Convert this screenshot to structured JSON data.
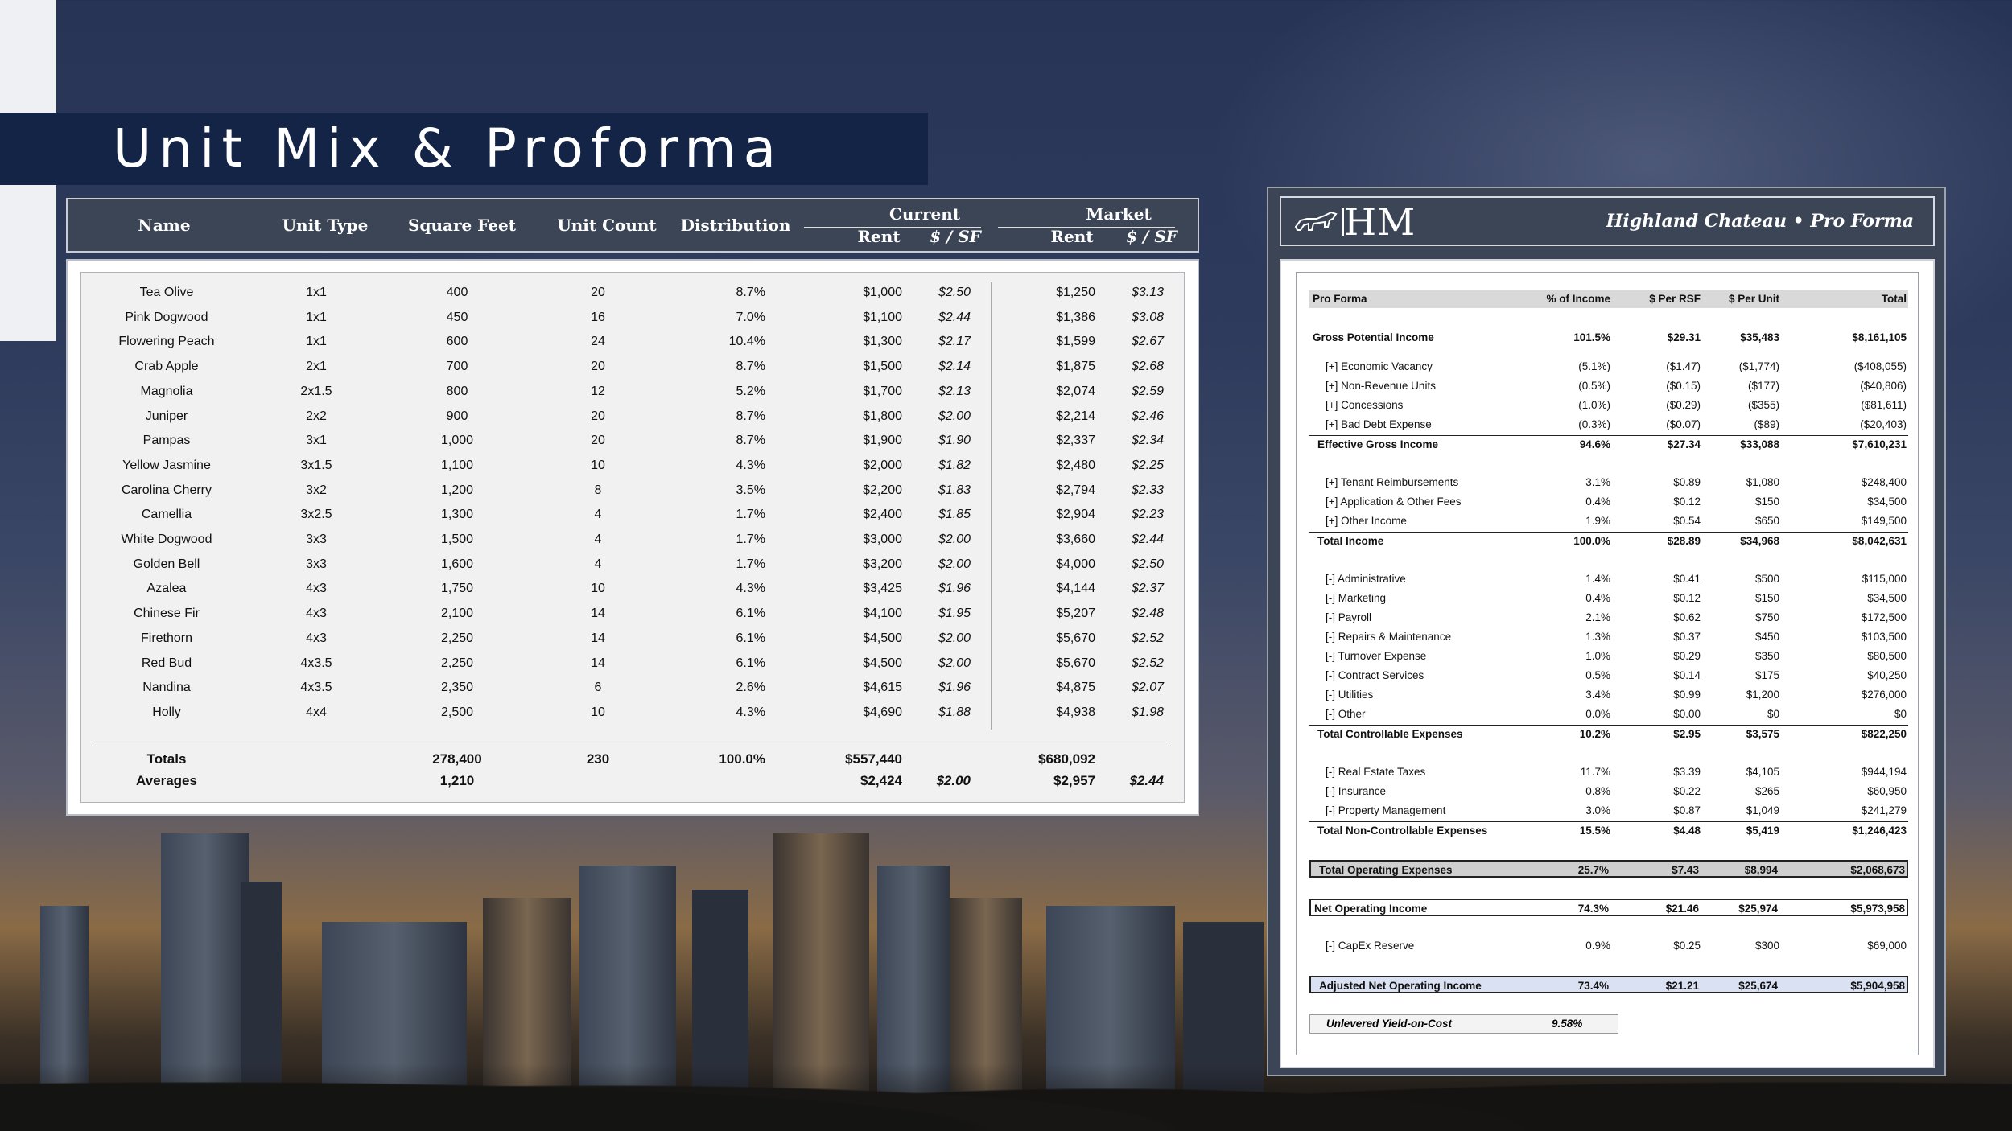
{
  "title": "Unit Mix & Proforma",
  "unit_mix": {
    "headers": {
      "name": "Name",
      "unit_type": "Unit Type",
      "square_feet": "Square Feet",
      "unit_count": "Unit Count",
      "distribution": "Distribution",
      "current": "Current",
      "market": "Market",
      "rent": "Rent",
      "psf": "$ / SF"
    },
    "rows": [
      {
        "name": "Tea Olive",
        "type": "1x1",
        "sf": "400",
        "count": "20",
        "dist": "8.7%",
        "rent": "$1,000",
        "psf": "$2.50",
        "mrent": "$1,250",
        "mpsf": "$3.13"
      },
      {
        "name": "Pink Dogwood",
        "type": "1x1",
        "sf": "450",
        "count": "16",
        "dist": "7.0%",
        "rent": "$1,100",
        "psf": "$2.44",
        "mrent": "$1,386",
        "mpsf": "$3.08"
      },
      {
        "name": "Flowering Peach",
        "type": "1x1",
        "sf": "600",
        "count": "24",
        "dist": "10.4%",
        "rent": "$1,300",
        "psf": "$2.17",
        "mrent": "$1,599",
        "mpsf": "$2.67"
      },
      {
        "name": "Crab Apple",
        "type": "2x1",
        "sf": "700",
        "count": "20",
        "dist": "8.7%",
        "rent": "$1,500",
        "psf": "$2.14",
        "mrent": "$1,875",
        "mpsf": "$2.68"
      },
      {
        "name": "Magnolia",
        "type": "2x1.5",
        "sf": "800",
        "count": "12",
        "dist": "5.2%",
        "rent": "$1,700",
        "psf": "$2.13",
        "mrent": "$2,074",
        "mpsf": "$2.59"
      },
      {
        "name": "Juniper",
        "type": "2x2",
        "sf": "900",
        "count": "20",
        "dist": "8.7%",
        "rent": "$1,800",
        "psf": "$2.00",
        "mrent": "$2,214",
        "mpsf": "$2.46"
      },
      {
        "name": "Pampas",
        "type": "3x1",
        "sf": "1,000",
        "count": "20",
        "dist": "8.7%",
        "rent": "$1,900",
        "psf": "$1.90",
        "mrent": "$2,337",
        "mpsf": "$2.34"
      },
      {
        "name": "Yellow Jasmine",
        "type": "3x1.5",
        "sf": "1,100",
        "count": "10",
        "dist": "4.3%",
        "rent": "$2,000",
        "psf": "$1.82",
        "mrent": "$2,480",
        "mpsf": "$2.25"
      },
      {
        "name": "Carolina Cherry",
        "type": "3x2",
        "sf": "1,200",
        "count": "8",
        "dist": "3.5%",
        "rent": "$2,200",
        "psf": "$1.83",
        "mrent": "$2,794",
        "mpsf": "$2.33"
      },
      {
        "name": "Camellia",
        "type": "3x2.5",
        "sf": "1,300",
        "count": "4",
        "dist": "1.7%",
        "rent": "$2,400",
        "psf": "$1.85",
        "mrent": "$2,904",
        "mpsf": "$2.23"
      },
      {
        "name": "White Dogwood",
        "type": "3x3",
        "sf": "1,500",
        "count": "4",
        "dist": "1.7%",
        "rent": "$3,000",
        "psf": "$2.00",
        "mrent": "$3,660",
        "mpsf": "$2.44"
      },
      {
        "name": "Golden Bell",
        "type": "3x3",
        "sf": "1,600",
        "count": "4",
        "dist": "1.7%",
        "rent": "$3,200",
        "psf": "$2.00",
        "mrent": "$4,000",
        "mpsf": "$2.50"
      },
      {
        "name": "Azalea",
        "type": "4x3",
        "sf": "1,750",
        "count": "10",
        "dist": "4.3%",
        "rent": "$3,425",
        "psf": "$1.96",
        "mrent": "$4,144",
        "mpsf": "$2.37"
      },
      {
        "name": "Chinese Fir",
        "type": "4x3",
        "sf": "2,100",
        "count": "14",
        "dist": "6.1%",
        "rent": "$4,100",
        "psf": "$1.95",
        "mrent": "$5,207",
        "mpsf": "$2.48"
      },
      {
        "name": "Firethorn",
        "type": "4x3",
        "sf": "2,250",
        "count": "14",
        "dist": "6.1%",
        "rent": "$4,500",
        "psf": "$2.00",
        "mrent": "$5,670",
        "mpsf": "$2.52"
      },
      {
        "name": "Red Bud",
        "type": "4x3.5",
        "sf": "2,250",
        "count": "14",
        "dist": "6.1%",
        "rent": "$4,500",
        "psf": "$2.00",
        "mrent": "$5,670",
        "mpsf": "$2.52"
      },
      {
        "name": "Nandina",
        "type": "4x3.5",
        "sf": "2,350",
        "count": "6",
        "dist": "2.6%",
        "rent": "$4,615",
        "psf": "$1.96",
        "mrent": "$4,875",
        "mpsf": "$2.07"
      },
      {
        "name": "Holly",
        "type": "4x4",
        "sf": "2,500",
        "count": "10",
        "dist": "4.3%",
        "rent": "$4,690",
        "psf": "$1.88",
        "mrent": "$4,938",
        "mpsf": "$1.98"
      }
    ],
    "totals": {
      "label": "Totals",
      "sf": "278,400",
      "count": "230",
      "dist": "100.0%",
      "rent": "$557,440",
      "mrent": "$680,092"
    },
    "averages": {
      "label": "Averages",
      "sf": "1,210",
      "rent": "$2,424",
      "psf": "$2.00",
      "mrent": "$2,957",
      "mpsf": "$2.44"
    }
  },
  "proforma": {
    "logo_text": "HM",
    "title": "Highland Chateau • Pro Forma",
    "headers": {
      "label": "Pro Forma",
      "c1": "% of Income",
      "c2": "$ Per RSF",
      "c3": "$ Per Unit",
      "c4": "Total"
    },
    "rows": [
      {
        "label": "Gross Potential Income",
        "c1": "101.5%",
        "c2": "$29.31",
        "c3": "$35,483",
        "c4": "$8,161,105"
      },
      {
        "label": "[+] Economic Vacancy",
        "c1": "(5.1%)",
        "c2": "($1.47)",
        "c3": "($1,774)",
        "c4": "($408,055)"
      },
      {
        "label": "[+] Non-Revenue Units",
        "c1": "(0.5%)",
        "c2": "($0.15)",
        "c3": "($177)",
        "c4": "($40,806)"
      },
      {
        "label": "[+] Concessions",
        "c1": "(1.0%)",
        "c2": "($0.29)",
        "c3": "($355)",
        "c4": "($81,611)"
      },
      {
        "label": "[+] Bad Debt Expense",
        "c1": "(0.3%)",
        "c2": "($0.07)",
        "c3": "($89)",
        "c4": "($20,403)"
      },
      {
        "label": "Effective Gross Income",
        "c1": "94.6%",
        "c2": "$27.34",
        "c3": "$33,088",
        "c4": "$7,610,231"
      },
      {
        "label": "[+] Tenant Reimbursements",
        "c1": "3.1%",
        "c2": "$0.89",
        "c3": "$1,080",
        "c4": "$248,400"
      },
      {
        "label": "[+] Application & Other Fees",
        "c1": "0.4%",
        "c2": "$0.12",
        "c3": "$150",
        "c4": "$34,500"
      },
      {
        "label": "[+] Other Income",
        "c1": "1.9%",
        "c2": "$0.54",
        "c3": "$650",
        "c4": "$149,500"
      },
      {
        "label": "Total Income",
        "c1": "100.0%",
        "c2": "$28.89",
        "c3": "$34,968",
        "c4": "$8,042,631"
      },
      {
        "label": "[-] Administrative",
        "c1": "1.4%",
        "c2": "$0.41",
        "c3": "$500",
        "c4": "$115,000"
      },
      {
        "label": "[-] Marketing",
        "c1": "0.4%",
        "c2": "$0.12",
        "c3": "$150",
        "c4": "$34,500"
      },
      {
        "label": "[-] Payroll",
        "c1": "2.1%",
        "c2": "$0.62",
        "c3": "$750",
        "c4": "$172,500"
      },
      {
        "label": "[-] Repairs & Maintenance",
        "c1": "1.3%",
        "c2": "$0.37",
        "c3": "$450",
        "c4": "$103,500"
      },
      {
        "label": "[-] Turnover Expense",
        "c1": "1.0%",
        "c2": "$0.29",
        "c3": "$350",
        "c4": "$80,500"
      },
      {
        "label": "[-] Contract Services",
        "c1": "0.5%",
        "c2": "$0.14",
        "c3": "$175",
        "c4": "$40,250"
      },
      {
        "label": "[-] Utilities",
        "c1": "3.4%",
        "c2": "$0.99",
        "c3": "$1,200",
        "c4": "$276,000"
      },
      {
        "label": "[-] Other",
        "c1": "0.0%",
        "c2": "$0.00",
        "c3": "$0",
        "c4": "$0"
      },
      {
        "label": "Total Controllable Expenses",
        "c1": "10.2%",
        "c2": "$2.95",
        "c3": "$3,575",
        "c4": "$822,250"
      },
      {
        "label": "[-] Real Estate Taxes",
        "c1": "11.7%",
        "c2": "$3.39",
        "c3": "$4,105",
        "c4": "$944,194"
      },
      {
        "label": "[-] Insurance",
        "c1": "0.8%",
        "c2": "$0.22",
        "c3": "$265",
        "c4": "$60,950"
      },
      {
        "label": "[-] Property Management",
        "c1": "3.0%",
        "c2": "$0.87",
        "c3": "$1,049",
        "c4": "$241,279"
      },
      {
        "label": "Total Non-Controllable Expenses",
        "c1": "15.5%",
        "c2": "$4.48",
        "c3": "$5,419",
        "c4": "$1,246,423"
      },
      {
        "label": "Total Operating Expenses",
        "c1": "25.7%",
        "c2": "$7.43",
        "c3": "$8,994",
        "c4": "$2,068,673"
      },
      {
        "label": "Net Operating Income",
        "c1": "74.3%",
        "c2": "$21.46",
        "c3": "$25,974",
        "c4": "$5,973,958"
      },
      {
        "label": "[-] CapEx Reserve",
        "c1": "0.9%",
        "c2": "$0.25",
        "c3": "$300",
        "c4": "$69,000"
      },
      {
        "label": "Adjusted Net Operating Income",
        "c1": "73.4%",
        "c2": "$21.21",
        "c3": "$25,674",
        "c4": "$5,904,958"
      }
    ],
    "yield": {
      "label": "Unlevered Yield-on-Cost",
      "value": "9.58%"
    }
  }
}
